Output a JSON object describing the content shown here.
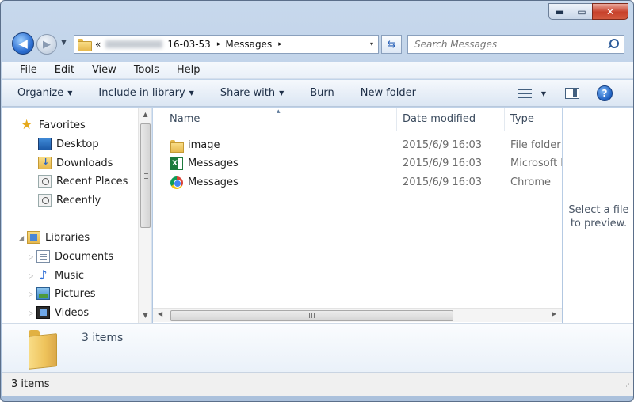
{
  "window": {
    "controls": {
      "minimize": "▬",
      "maximize": "▭",
      "close": "✕"
    }
  },
  "address": {
    "prefix": "«",
    "crumbs": [
      "16-03-53",
      "Messages"
    ],
    "separator": "▸",
    "dropdown": "▾"
  },
  "search": {
    "placeholder": "Search Messages"
  },
  "menu": [
    "File",
    "Edit",
    "View",
    "Tools",
    "Help"
  ],
  "commandbar": {
    "organize": "Organize",
    "include_in_library": "Include in library",
    "share_with": "Share with",
    "burn": "Burn",
    "new_folder": "New folder",
    "dropdown_glyph": "▼",
    "help_glyph": "?"
  },
  "navpane": {
    "favorites": {
      "label": "Favorites",
      "items": [
        "Desktop",
        "Downloads",
        "Recent Places",
        "Recently"
      ]
    },
    "libraries": {
      "label": "Libraries",
      "items": [
        "Documents",
        "Music",
        "Pictures",
        "Videos"
      ]
    },
    "expand_glyph": "▷",
    "collapse_glyph": "◢"
  },
  "filelist": {
    "columns": {
      "name": "Name",
      "date_modified": "Date modified",
      "type": "Type"
    },
    "sort_indicator": "▴",
    "rows": [
      {
        "name": "image",
        "date": "2015/6/9 16:03",
        "type": "File folder",
        "icon": "folder-icon"
      },
      {
        "name": "Messages",
        "date": "2015/6/9 16:03",
        "type": "Microsoft Excel",
        "icon": "excel-icon"
      },
      {
        "name": "Messages",
        "date": "2015/6/9 16:03",
        "type": "Chrome",
        "icon": "chrome-icon"
      }
    ]
  },
  "preview": {
    "text_line1": "Select a file",
    "text_line2": "to preview."
  },
  "details": {
    "item_count": "3 items"
  },
  "status": {
    "item_count": "3 items"
  }
}
